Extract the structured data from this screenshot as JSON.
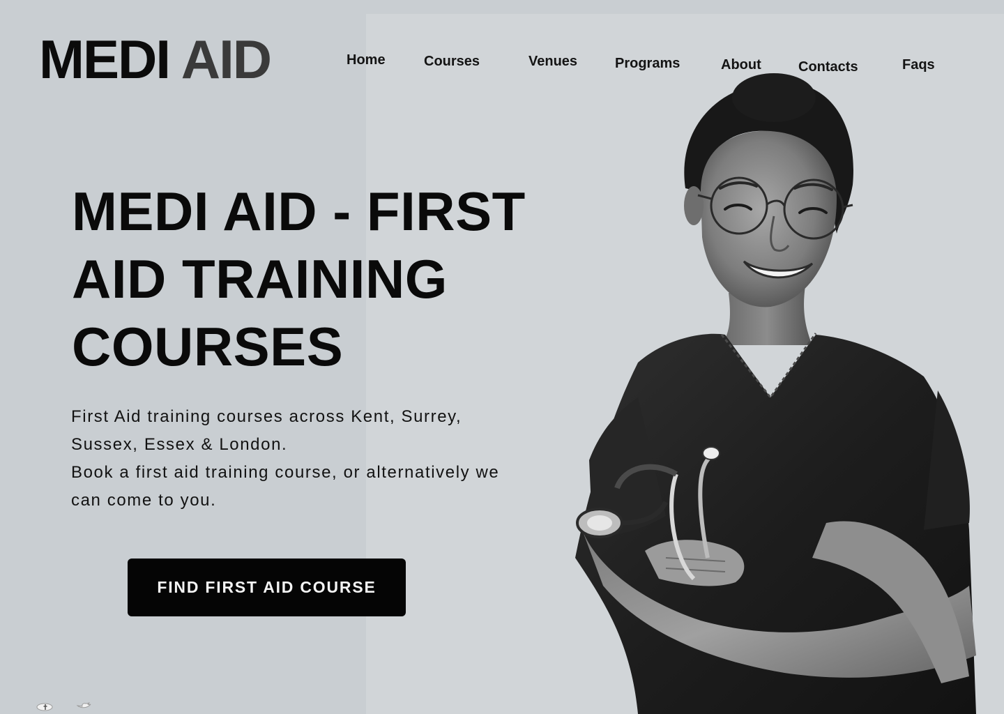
{
  "brand": {
    "part1": "MEDI",
    "part2": "AID"
  },
  "nav": [
    {
      "label": "Home"
    },
    {
      "label": "Courses"
    },
    {
      "label": "Venues"
    },
    {
      "label": "Programs"
    },
    {
      "label": "About"
    },
    {
      "label": "Contacts"
    },
    {
      "label": "Faqs"
    }
  ],
  "hero": {
    "title": "MEDI AID - FIRST AID TRAINING COURSES",
    "copy_line1": "First Aid training courses across Kent, Surrey,",
    "copy_line2": "Sussex, Essex & London.",
    "copy_line3": "Book a first aid training course, or alternatively we",
    "copy_line4": "can come to you.",
    "cta": "FIND FIRST AID COURSE"
  },
  "social": [
    {
      "icon": "facebook-icon"
    },
    {
      "icon": "twitter-icon"
    }
  ],
  "colors": {
    "background": "#c9ced2",
    "text": "#0b0b0b",
    "button": "#050505",
    "button_text": "#f4f4f4"
  }
}
